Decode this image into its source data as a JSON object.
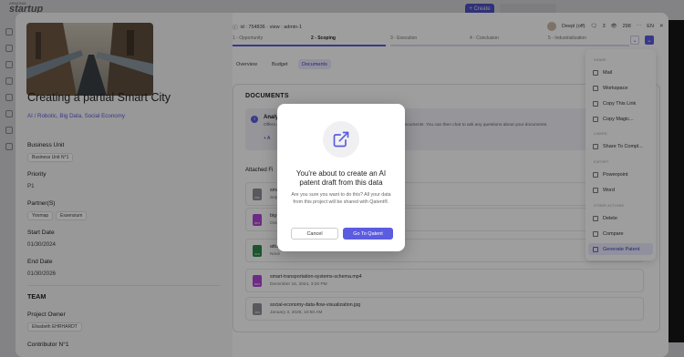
{
  "app": {
    "logo_small": "ARMONIA",
    "logo_word": "startup",
    "create_label": "+ Create",
    "search_placeholder": "Search"
  },
  "project": {
    "meta_id": "id : 754836 · view : admin-1",
    "title": "Creating a partial Smart City",
    "tags": "AI / Robotic, Big Data, Social Economy",
    "business_unit_label": "Business Unit",
    "business_unit_value": "Business Unit N°1",
    "priority_label": "Priority",
    "priority_value": "P1",
    "partners_label": "Partner(S)",
    "partners": [
      "Yoomap",
      "Essensium"
    ],
    "start_label": "Start Date",
    "start_value": "01/30/2024",
    "end_label": "End Date",
    "end_value": "01/30/2026",
    "team_title": "TEAM",
    "owner_label": "Project Owner",
    "owner_value": "Elisabeth EHRHARDT",
    "contributor_label": "Contributor N°1"
  },
  "header": {
    "user": "Deepl (off)",
    "comments": "3",
    "views": "298",
    "lang": "EN"
  },
  "stages": [
    "1 - Opportunity",
    "2 - Scoping",
    "3 - Execution",
    "4 - Conclusion",
    "5 - Industrialization"
  ],
  "tabs": [
    "Overview",
    "Budget",
    "Documents"
  ],
  "documents": {
    "title": "DOCUMENTS",
    "analyze_title": "Analyze",
    "analyze_text": "Offers a",
    "analyze_hint": "documents. You can then chat to ask any questions about your documents.",
    "analyze_btn": "+ A",
    "attached_label": "Attached Fi",
    "files": [
      {
        "name": "sma",
        "date": "Sep",
        "ext": "PDF",
        "color": "#8e8e96"
      },
      {
        "name": "big-",
        "date": "Octo",
        "ext": "MP4",
        "color": "#b146d6"
      },
      {
        "name": "attu",
        "date": "Nove",
        "ext": "XLS",
        "color": "#2e8a4a"
      },
      {
        "name": "smart-transportation-systems-schema.mp4",
        "date": "December 15, 2024, 3:20 PM",
        "ext": "MP4",
        "color": "#b146d6"
      },
      {
        "name": "social-economy-data-flow-visualization.jpg",
        "date": "January 3, 2025, 10:50 AM",
        "ext": "JPG",
        "color": "#8e8e96"
      }
    ]
  },
  "menu": {
    "sections": [
      "SHARE",
      "LINKED",
      "EXPORT",
      "OTHER ACTIONS"
    ],
    "share": [
      "Mail",
      "Workspace",
      "Copy This Link",
      "Copy Magic..."
    ],
    "linked": [
      "Share To Compl..."
    ],
    "export": [
      "Powerpoint",
      "Word"
    ],
    "other": [
      "Delete",
      "Compare",
      "Generate Patent"
    ]
  },
  "modal": {
    "title": "You're about to create an AI patent draft from this data",
    "body": "Are you sure you want to do this? All your data from this project will be shared with Qatent®.",
    "cancel": "Cancel",
    "confirm": "Go To Qatent"
  }
}
